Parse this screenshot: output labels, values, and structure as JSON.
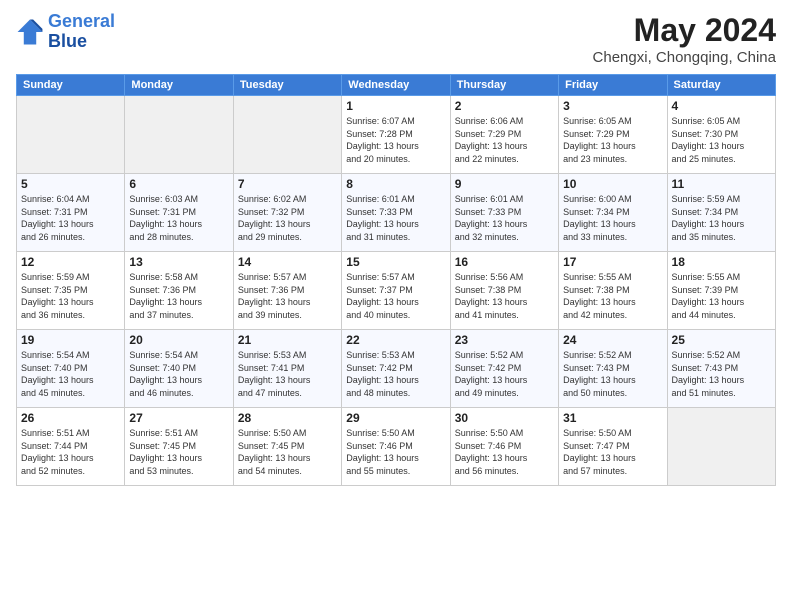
{
  "header": {
    "logo_line1": "General",
    "logo_line2": "Blue",
    "month": "May 2024",
    "location": "Chengxi, Chongqing, China"
  },
  "weekdays": [
    "Sunday",
    "Monday",
    "Tuesday",
    "Wednesday",
    "Thursday",
    "Friday",
    "Saturday"
  ],
  "weeks": [
    [
      {
        "day": "",
        "info": ""
      },
      {
        "day": "",
        "info": ""
      },
      {
        "day": "",
        "info": ""
      },
      {
        "day": "1",
        "info": "Sunrise: 6:07 AM\nSunset: 7:28 PM\nDaylight: 13 hours\nand 20 minutes."
      },
      {
        "day": "2",
        "info": "Sunrise: 6:06 AM\nSunset: 7:29 PM\nDaylight: 13 hours\nand 22 minutes."
      },
      {
        "day": "3",
        "info": "Sunrise: 6:05 AM\nSunset: 7:29 PM\nDaylight: 13 hours\nand 23 minutes."
      },
      {
        "day": "4",
        "info": "Sunrise: 6:05 AM\nSunset: 7:30 PM\nDaylight: 13 hours\nand 25 minutes."
      }
    ],
    [
      {
        "day": "5",
        "info": "Sunrise: 6:04 AM\nSunset: 7:31 PM\nDaylight: 13 hours\nand 26 minutes."
      },
      {
        "day": "6",
        "info": "Sunrise: 6:03 AM\nSunset: 7:31 PM\nDaylight: 13 hours\nand 28 minutes."
      },
      {
        "day": "7",
        "info": "Sunrise: 6:02 AM\nSunset: 7:32 PM\nDaylight: 13 hours\nand 29 minutes."
      },
      {
        "day": "8",
        "info": "Sunrise: 6:01 AM\nSunset: 7:33 PM\nDaylight: 13 hours\nand 31 minutes."
      },
      {
        "day": "9",
        "info": "Sunrise: 6:01 AM\nSunset: 7:33 PM\nDaylight: 13 hours\nand 32 minutes."
      },
      {
        "day": "10",
        "info": "Sunrise: 6:00 AM\nSunset: 7:34 PM\nDaylight: 13 hours\nand 33 minutes."
      },
      {
        "day": "11",
        "info": "Sunrise: 5:59 AM\nSunset: 7:34 PM\nDaylight: 13 hours\nand 35 minutes."
      }
    ],
    [
      {
        "day": "12",
        "info": "Sunrise: 5:59 AM\nSunset: 7:35 PM\nDaylight: 13 hours\nand 36 minutes."
      },
      {
        "day": "13",
        "info": "Sunrise: 5:58 AM\nSunset: 7:36 PM\nDaylight: 13 hours\nand 37 minutes."
      },
      {
        "day": "14",
        "info": "Sunrise: 5:57 AM\nSunset: 7:36 PM\nDaylight: 13 hours\nand 39 minutes."
      },
      {
        "day": "15",
        "info": "Sunrise: 5:57 AM\nSunset: 7:37 PM\nDaylight: 13 hours\nand 40 minutes."
      },
      {
        "day": "16",
        "info": "Sunrise: 5:56 AM\nSunset: 7:38 PM\nDaylight: 13 hours\nand 41 minutes."
      },
      {
        "day": "17",
        "info": "Sunrise: 5:55 AM\nSunset: 7:38 PM\nDaylight: 13 hours\nand 42 minutes."
      },
      {
        "day": "18",
        "info": "Sunrise: 5:55 AM\nSunset: 7:39 PM\nDaylight: 13 hours\nand 44 minutes."
      }
    ],
    [
      {
        "day": "19",
        "info": "Sunrise: 5:54 AM\nSunset: 7:40 PM\nDaylight: 13 hours\nand 45 minutes."
      },
      {
        "day": "20",
        "info": "Sunrise: 5:54 AM\nSunset: 7:40 PM\nDaylight: 13 hours\nand 46 minutes."
      },
      {
        "day": "21",
        "info": "Sunrise: 5:53 AM\nSunset: 7:41 PM\nDaylight: 13 hours\nand 47 minutes."
      },
      {
        "day": "22",
        "info": "Sunrise: 5:53 AM\nSunset: 7:42 PM\nDaylight: 13 hours\nand 48 minutes."
      },
      {
        "day": "23",
        "info": "Sunrise: 5:52 AM\nSunset: 7:42 PM\nDaylight: 13 hours\nand 49 minutes."
      },
      {
        "day": "24",
        "info": "Sunrise: 5:52 AM\nSunset: 7:43 PM\nDaylight: 13 hours\nand 50 minutes."
      },
      {
        "day": "25",
        "info": "Sunrise: 5:52 AM\nSunset: 7:43 PM\nDaylight: 13 hours\nand 51 minutes."
      }
    ],
    [
      {
        "day": "26",
        "info": "Sunrise: 5:51 AM\nSunset: 7:44 PM\nDaylight: 13 hours\nand 52 minutes."
      },
      {
        "day": "27",
        "info": "Sunrise: 5:51 AM\nSunset: 7:45 PM\nDaylight: 13 hours\nand 53 minutes."
      },
      {
        "day": "28",
        "info": "Sunrise: 5:50 AM\nSunset: 7:45 PM\nDaylight: 13 hours\nand 54 minutes."
      },
      {
        "day": "29",
        "info": "Sunrise: 5:50 AM\nSunset: 7:46 PM\nDaylight: 13 hours\nand 55 minutes."
      },
      {
        "day": "30",
        "info": "Sunrise: 5:50 AM\nSunset: 7:46 PM\nDaylight: 13 hours\nand 56 minutes."
      },
      {
        "day": "31",
        "info": "Sunrise: 5:50 AM\nSunset: 7:47 PM\nDaylight: 13 hours\nand 57 minutes."
      },
      {
        "day": "",
        "info": ""
      }
    ]
  ]
}
